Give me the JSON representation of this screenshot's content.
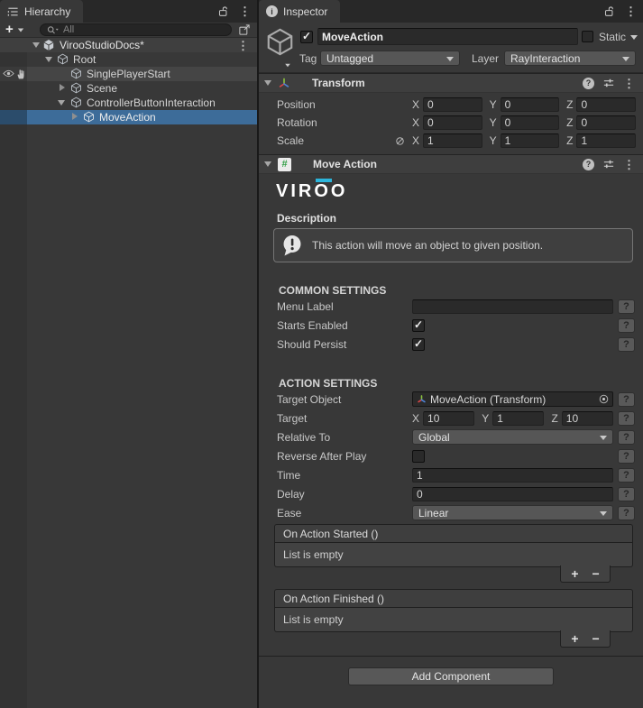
{
  "colors": {
    "selection_blue": "#3D6C99",
    "selection_gutter_blue": "#2B4C6B",
    "brand_cyan": "#2CB5DB"
  },
  "hierarchy": {
    "tab_label": "Hierarchy",
    "toolbar": {
      "add_label": "+",
      "search_value": "All"
    },
    "nodes": [
      {
        "name": "VirooStudioDocs*",
        "type": "scene",
        "expanded": true
      },
      {
        "name": "Root",
        "expanded": true
      },
      {
        "name": "SinglePlayerStart",
        "visibility_icons": true
      },
      {
        "name": "Scene",
        "expanded": false
      },
      {
        "name": "ControllerButtonInteraction",
        "expanded": true
      },
      {
        "name": "MoveAction",
        "expanded": false,
        "selected": true
      }
    ]
  },
  "inspector": {
    "tab_label": "Inspector",
    "help_label": "?",
    "axis": {
      "x": "X",
      "y": "Y",
      "z": "Z"
    },
    "gameobject": {
      "name": "MoveAction",
      "active_checked": true,
      "static_label": "Static",
      "static_checked": false,
      "tag_label": "Tag",
      "tag_value": "Untagged",
      "layer_label": "Layer",
      "layer_value": "RayInteraction"
    },
    "transform": {
      "title": "Transform",
      "position": {
        "label": "Position",
        "x": "0",
        "y": "0",
        "z": "0"
      },
      "rotation": {
        "label": "Rotation",
        "x": "0",
        "y": "0",
        "z": "0"
      },
      "scale": {
        "label": "Scale",
        "x": "1",
        "y": "1",
        "z": "1"
      }
    },
    "move_action": {
      "title": "Move Action",
      "logo_text": "VIROO",
      "description_label": "Description",
      "description_text": "This action will move an object to given position.",
      "common_title": "COMMON SETTINGS",
      "menu_label": {
        "label": "Menu Label",
        "value": ""
      },
      "starts_enabled": {
        "label": "Starts Enabled",
        "checked": true
      },
      "should_persist": {
        "label": "Should Persist",
        "checked": true
      },
      "action_title": "ACTION SETTINGS",
      "target_object": {
        "label": "Target Object",
        "value": "MoveAction (Transform)"
      },
      "target": {
        "label": "Target",
        "x": "10",
        "y": "1",
        "z": "10"
      },
      "relative_to": {
        "label": "Relative To",
        "value": "Global"
      },
      "reverse_after_play": {
        "label": "Reverse After Play",
        "checked": false
      },
      "time": {
        "label": "Time",
        "value": "1"
      },
      "delay": {
        "label": "Delay",
        "value": "0"
      },
      "ease": {
        "label": "Ease",
        "value": "Linear"
      },
      "events": [
        {
          "title": "On Action Started ()",
          "empty_label": "List is empty",
          "add_label": "+",
          "remove_label": "−"
        },
        {
          "title": "On Action Finished ()",
          "empty_label": "List is empty",
          "add_label": "+",
          "remove_label": "−"
        }
      ]
    },
    "add_component_label": "Add Component"
  }
}
